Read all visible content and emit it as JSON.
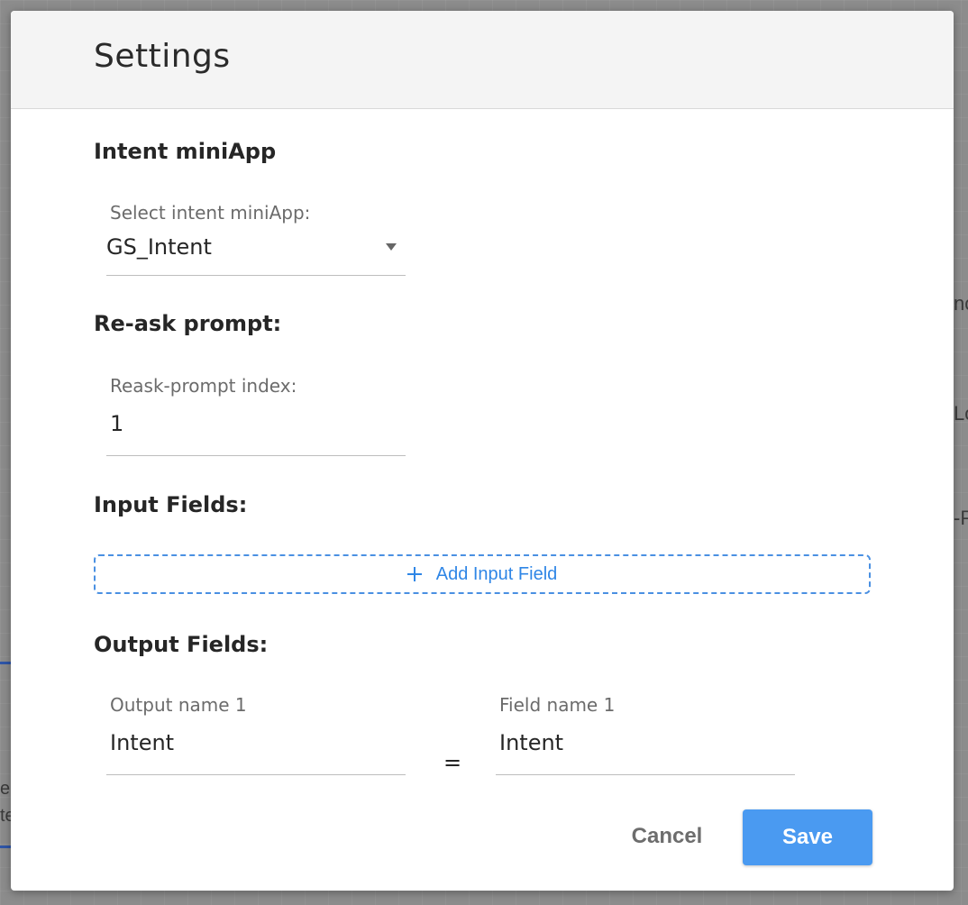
{
  "background": {
    "fragments": [
      "nc",
      "Lo",
      "-P",
      "e",
      "te"
    ]
  },
  "modal": {
    "title": "Settings"
  },
  "intent_section": {
    "title": "Intent miniApp",
    "select_label": "Select intent miniApp:",
    "select_value": "GS_Intent"
  },
  "reask_section": {
    "title": "Re-ask prompt:",
    "index_label": "Reask-prompt index:",
    "index_value": "1"
  },
  "input_section": {
    "title": "Input Fields:",
    "add_button_label": "Add Input Field"
  },
  "output_section": {
    "title": "Output Fields:",
    "output_name_label": "Output name 1",
    "output_name_value": "Intent",
    "equals": "=",
    "field_name_label": "Field name 1",
    "field_name_value": "Intent"
  },
  "actions": {
    "cancel_label": "Cancel",
    "save_label": "Save"
  },
  "colors": {
    "accent": "#4a9af1",
    "link": "#2f86e6"
  },
  "icons": {
    "add": "plus-icon",
    "dropdown": "caret-down-icon"
  }
}
